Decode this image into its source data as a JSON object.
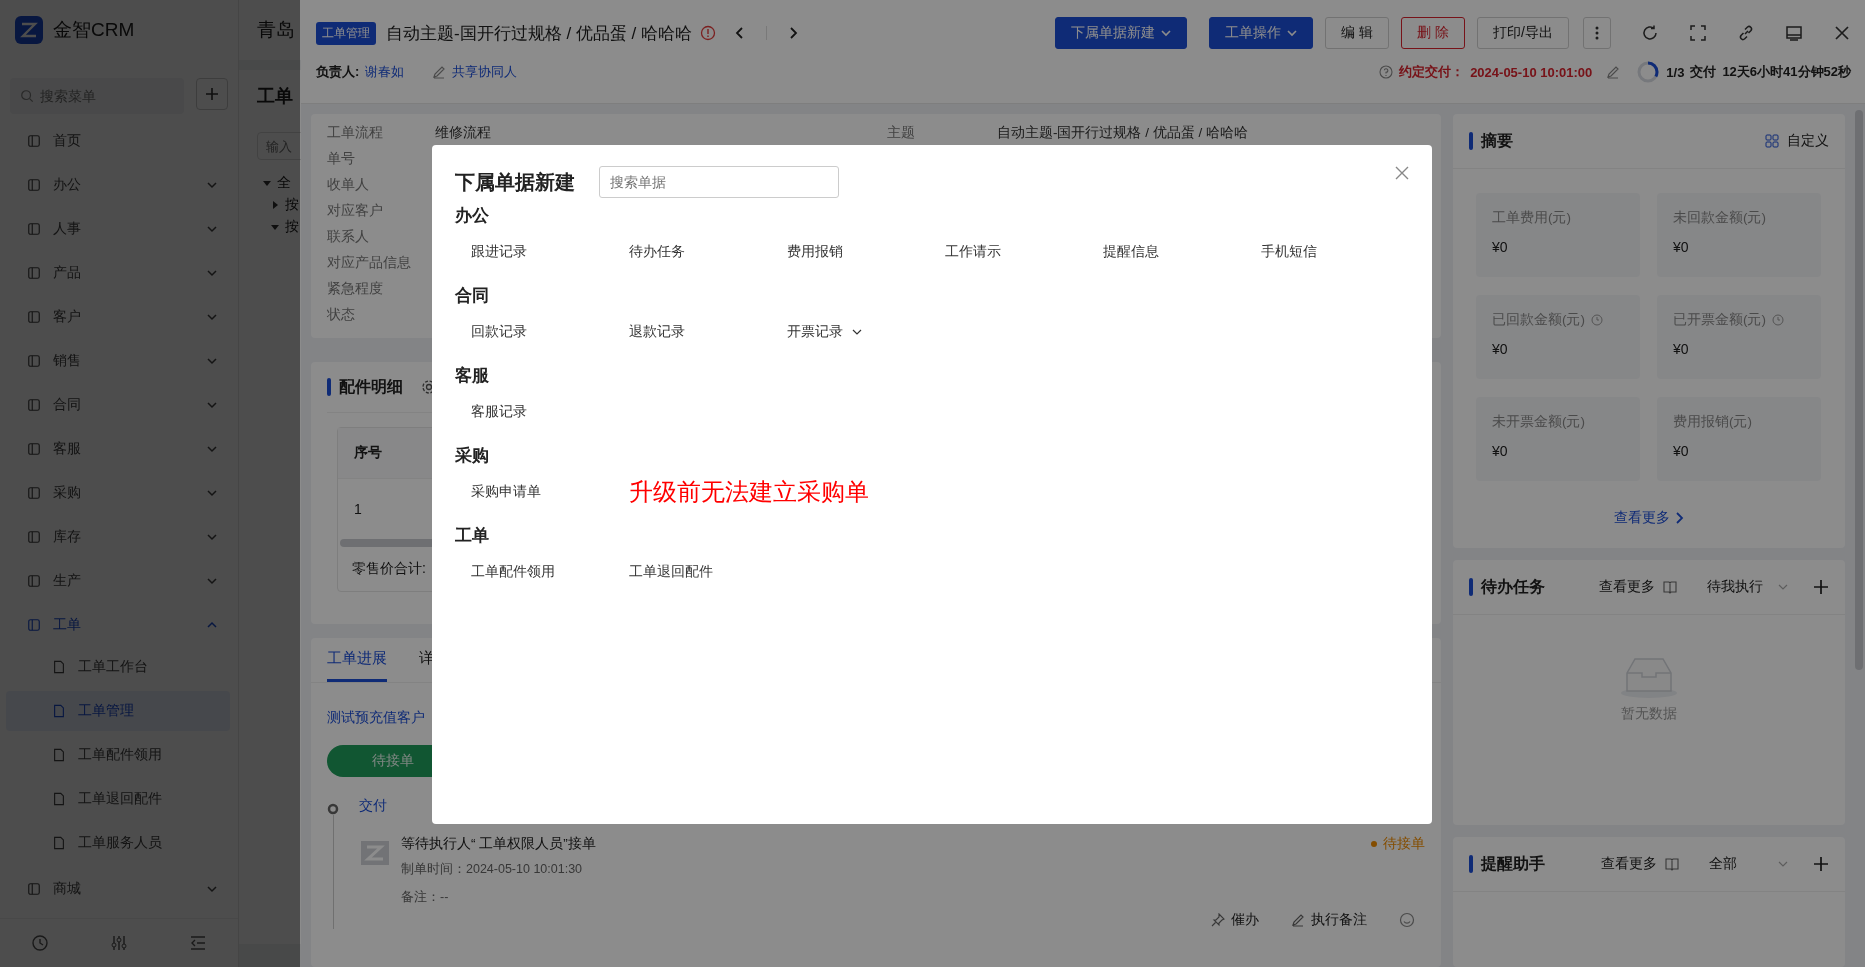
{
  "app": {
    "logo": "金智CRM"
  },
  "sidebar": {
    "search_placeholder": "搜索菜单",
    "items": [
      {
        "label": "首页",
        "kind": "page"
      },
      {
        "label": "办公",
        "kind": "group",
        "expanded": false
      },
      {
        "label": "人事",
        "kind": "group",
        "expanded": false
      },
      {
        "label": "产品",
        "kind": "group",
        "expanded": false
      },
      {
        "label": "客户",
        "kind": "group",
        "expanded": false
      },
      {
        "label": "销售",
        "kind": "group",
        "expanded": false
      },
      {
        "label": "合同",
        "kind": "group",
        "expanded": false
      },
      {
        "label": "客服",
        "kind": "group",
        "expanded": false
      },
      {
        "label": "采购",
        "kind": "group",
        "expanded": false
      },
      {
        "label": "库存",
        "kind": "group",
        "expanded": false
      },
      {
        "label": "生产",
        "kind": "group",
        "expanded": false
      },
      {
        "label": "工单",
        "kind": "group",
        "expanded": true,
        "children": [
          {
            "label": "工单工作台",
            "selected": false
          },
          {
            "label": "工单管理",
            "selected": true
          },
          {
            "label": "工单配件领用",
            "selected": false
          },
          {
            "label": "工单退回配件",
            "selected": false
          },
          {
            "label": "工单服务人员",
            "selected": false
          }
        ]
      },
      {
        "label": "商城",
        "kind": "group",
        "expanded": false
      }
    ]
  },
  "list_page": {
    "header": "青岛",
    "title": "工单",
    "search_placeholder": "输入",
    "tree": [
      {
        "label": "全",
        "expanded": true,
        "children": [
          {
            "label": "按",
            "expanded": false
          },
          {
            "label": "按",
            "expanded": true
          }
        ]
      }
    ]
  },
  "detail": {
    "module_tag": "工单管理",
    "title": "自动主题-国开行过规格 / 优品蛋 / 哈哈哈",
    "buttons": [
      {
        "label": "下属单据新建",
        "kind": "primary"
      },
      {
        "label": "工单操作",
        "kind": "primary"
      },
      {
        "label": "编 辑",
        "kind": "default"
      },
      {
        "label": "删 除",
        "kind": "danger"
      },
      {
        "label": "打印/导出",
        "kind": "default"
      }
    ],
    "owner_label": "负责人:",
    "owner": "谢春如",
    "share": "共享协同人",
    "due_label": "约定交付：",
    "due": "2024-05-10 10:01:00",
    "stage_ring": {
      "level": 0.33
    },
    "stage_progress": "1/3",
    "stage": "交付",
    "remaining": "12天6小时41分钟52秒",
    "info": {
      "fields_left": [
        {
          "label": "工单流程",
          "value": "维修流程"
        },
        {
          "label": "单号"
        },
        {
          "label": "收单人"
        },
        {
          "label": "对应客户"
        },
        {
          "label": "联系人"
        },
        {
          "label": "对应产品信息"
        },
        {
          "label": "紧急程度"
        },
        {
          "label": "状态"
        }
      ],
      "fields_right": [
        {
          "label": "主题",
          "value": "自动主题-国开行过规格 / 优品蛋 / 哈哈哈"
        }
      ]
    },
    "parts": {
      "title": "配件明细",
      "columns": [
        "序号"
      ],
      "rows": [
        [
          "1"
        ]
      ],
      "total_label": "零售价合计:"
    },
    "progress": {
      "tabs": [
        {
          "label": "工单进展",
          "selected": true
        },
        {
          "label": "详",
          "selected": false
        }
      ],
      "customer": "测试预充值客户",
      "stage_button": "待接单",
      "timeline": [
        {
          "title": "交付",
          "text": "等待执行人“ 工单权限人员”接单",
          "time_label": "制单时间：",
          "time": "2024-05-10 10:01:30",
          "note": "备注：--",
          "status": "待接单",
          "actions": [
            "催办",
            "执行备注"
          ]
        }
      ]
    },
    "summary": {
      "title": "摘要",
      "customize": "自定义",
      "tiles": [
        {
          "label": "工单费用(元)",
          "value": "¥0",
          "clock": false
        },
        {
          "label": "未回款金额(元)",
          "value": "¥0",
          "clock": false
        },
        {
          "label": "已回款金额(元)",
          "value": "¥0",
          "clock": true
        },
        {
          "label": "已开票金额(元)",
          "value": "¥0",
          "clock": true
        },
        {
          "label": "未开票金额(元)",
          "value": "¥0",
          "clock": false
        },
        {
          "label": "费用报销(元)",
          "value": "¥0",
          "clock": false
        }
      ],
      "more": "查看更多"
    },
    "tasks": {
      "title": "待办任务",
      "more": "查看更多",
      "filter": "待我执行",
      "empty": "暂无数据"
    },
    "reminders": {
      "title": "提醒助手",
      "more": "查看更多",
      "filter": "全部"
    }
  },
  "dialog": {
    "title": "下属单据新建",
    "search_placeholder": "搜索单据",
    "sections": [
      {
        "title": "办公",
        "items": [
          {
            "label": "跟进记录",
            "dropdown": false
          },
          {
            "label": "待办任务",
            "dropdown": false
          },
          {
            "label": "费用报销",
            "dropdown": false
          },
          {
            "label": "工作请示",
            "dropdown": false
          },
          {
            "label": "提醒信息",
            "dropdown": false
          },
          {
            "label": "手机短信",
            "dropdown": false
          }
        ]
      },
      {
        "title": "合同",
        "items": [
          {
            "label": "回款记录",
            "dropdown": false
          },
          {
            "label": "退款记录",
            "dropdown": false
          },
          {
            "label": "开票记录",
            "dropdown": true
          }
        ]
      },
      {
        "title": "客服",
        "items": [
          {
            "label": "客服记录",
            "dropdown": false
          }
        ]
      },
      {
        "title": "采购",
        "items": [
          {
            "label": "采购申请单",
            "dropdown": false
          }
        ],
        "note": "升级前无法建立采购单"
      },
      {
        "title": "工单",
        "items": [
          {
            "label": "工单配件领用",
            "dropdown": false
          },
          {
            "label": "工单退回配件",
            "dropdown": false
          }
        ]
      }
    ]
  }
}
